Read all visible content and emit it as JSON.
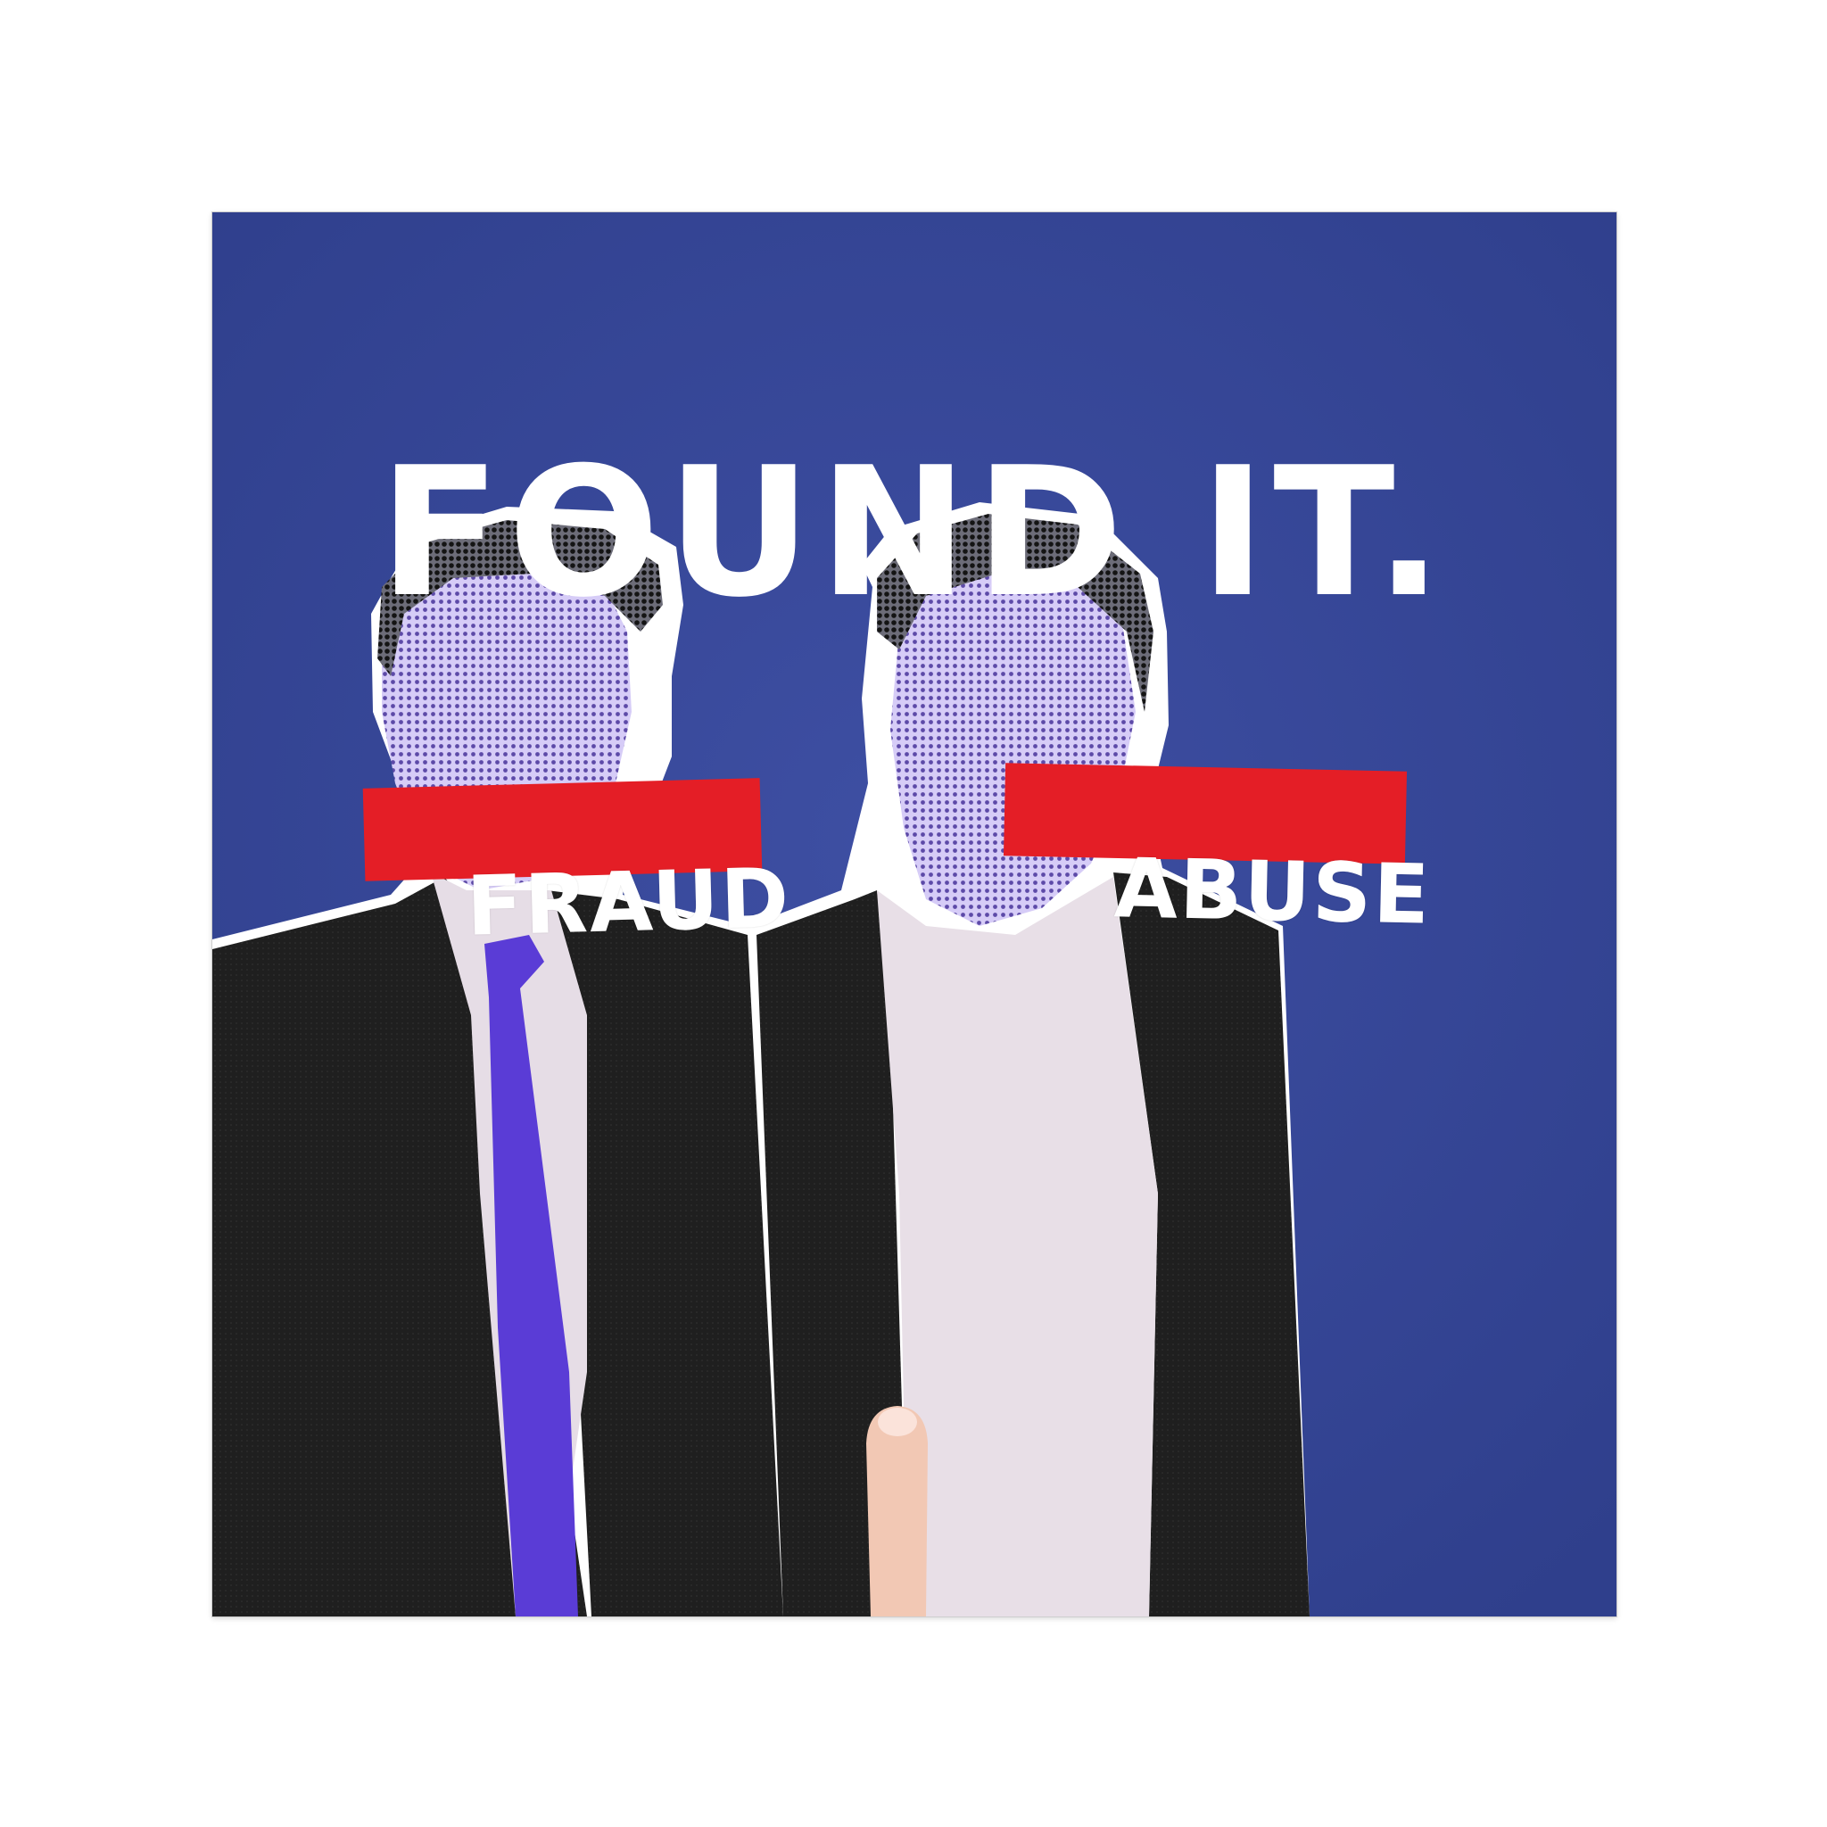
{
  "poster": {
    "headline": "FOUND IT.",
    "left_bar_label": "FRAUD",
    "right_bar_label": "ABUSE"
  },
  "colors": {
    "background_blue": "#3a4a9a",
    "censor_red": "#e41e26",
    "suit_black": "#1e1e1e",
    "tie_purple": "#5a3cd6",
    "halftone_tint": "#b9a9f0",
    "outline_white": "#ffffff"
  },
  "icons": [
    "left-figure",
    "right-figure",
    "finger-graphic"
  ]
}
